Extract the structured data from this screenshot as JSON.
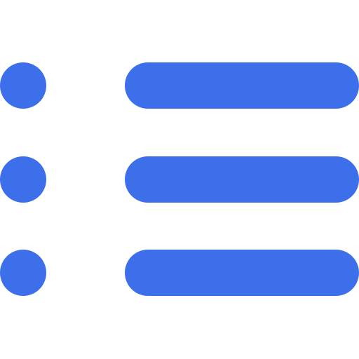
{
  "icon": {
    "name": "list-icon",
    "color": "#3D6FEA",
    "rows": [
      {
        "name": "list-row-1"
      },
      {
        "name": "list-row-2"
      },
      {
        "name": "list-row-3"
      }
    ]
  }
}
